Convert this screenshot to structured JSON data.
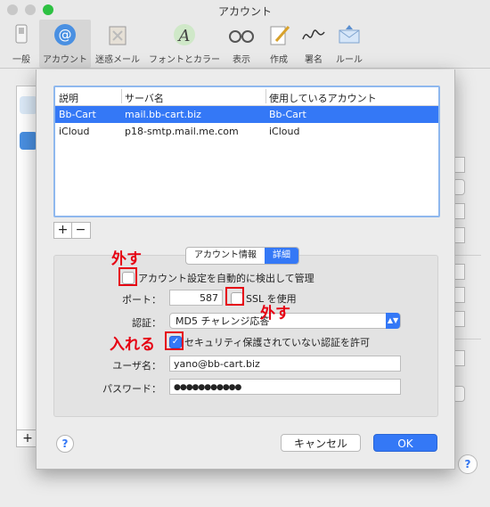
{
  "window": {
    "title": "アカウント"
  },
  "toolbar": [
    {
      "label": "一般",
      "icon": "switch-icon"
    },
    {
      "label": "アカウント",
      "icon": "at-icon",
      "active": true
    },
    {
      "label": "迷惑メール",
      "icon": "trash-icon"
    },
    {
      "label": "フォントとカラー",
      "icon": "font-icon"
    },
    {
      "label": "表示",
      "icon": "glasses-icon"
    },
    {
      "label": "作成",
      "icon": "pen-icon"
    },
    {
      "label": "署名",
      "icon": "signature-icon"
    },
    {
      "label": "ルール",
      "icon": "envelope-icon"
    }
  ],
  "table": {
    "headers": [
      "説明",
      "サーバ名",
      "使用しているアカウント"
    ],
    "rows": [
      [
        "Bb-Cart",
        "mail.bb-cart.biz",
        "Bb-Cart"
      ],
      [
        "iCloud",
        "p18-smtp.mail.me.com",
        "iCloud"
      ]
    ]
  },
  "tabs": {
    "account_info": "アカウント情報",
    "details": "詳細"
  },
  "form": {
    "auto_manage_label": "アカウント設定を自動的に検出して管理",
    "port_label": "ポート：",
    "port_value": "587",
    "ssl_label": "SSL を使用",
    "auth_label": "認証：",
    "auth_value": "MD5 チャレンジ応答",
    "insecure_auth_label": "セキュリティ保護されていない認証を許可",
    "username_label": "ユーザ名：",
    "username_value": "yano@bb-cart.biz",
    "password_label": "パスワード：",
    "password_value": "●●●●●●●●●●●"
  },
  "buttons": {
    "cancel": "キャンセル",
    "ok": "OK",
    "help": "?",
    "add": "+",
    "remove": "−"
  },
  "annotations": {
    "remove1": "外す",
    "remove2": "外す",
    "insert": "入れる"
  },
  "colors": {
    "accent": "#3478f6",
    "annotation": "#e60012"
  }
}
